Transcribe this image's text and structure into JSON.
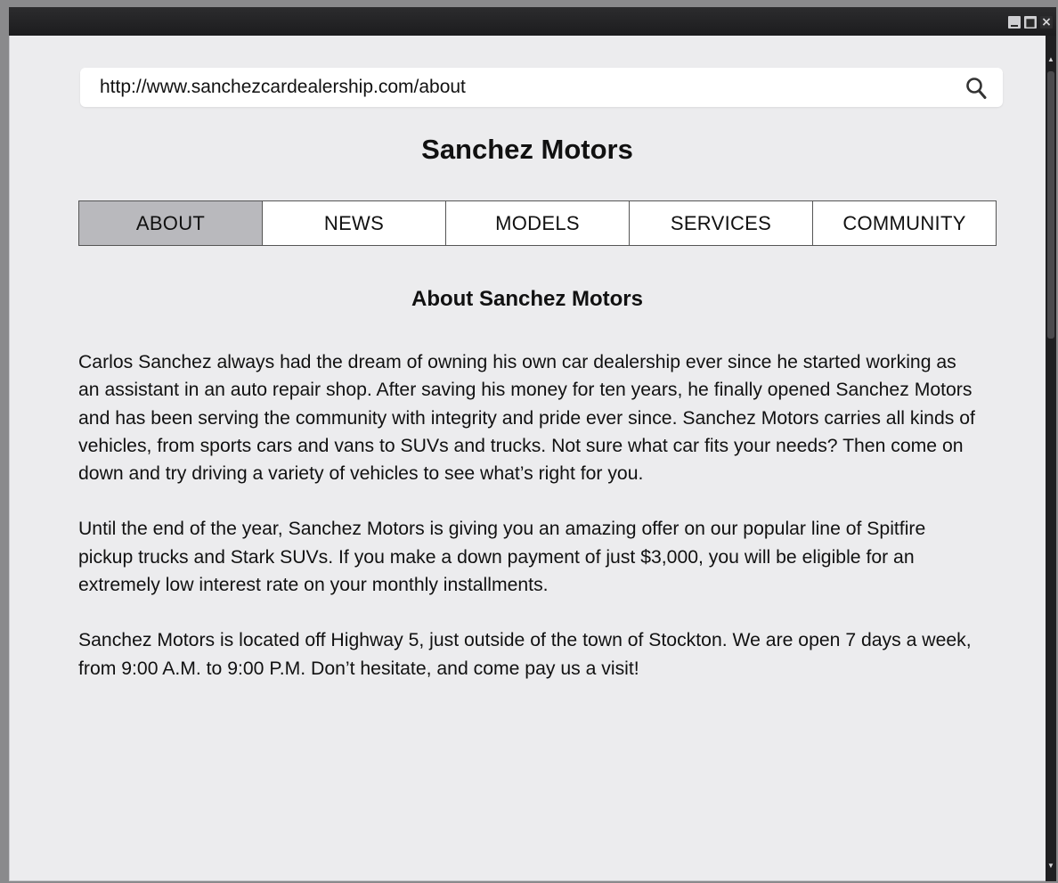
{
  "browser": {
    "url": "http://www.sanchezcardealership.com/about"
  },
  "site": {
    "title": "Sanchez Motors"
  },
  "nav": {
    "tabs": [
      {
        "label": "ABOUT",
        "active": true
      },
      {
        "label": "NEWS",
        "active": false
      },
      {
        "label": "MODELS",
        "active": false
      },
      {
        "label": "SERVICES",
        "active": false
      },
      {
        "label": "COMMUNITY",
        "active": false
      }
    ]
  },
  "main": {
    "heading": "About Sanchez Motors",
    "paragraphs": [
      "Carlos Sanchez always had the dream of owning his own car dealership ever since he started working as an assistant in an auto repair shop. After saving his money for ten years, he finally opened Sanchez Motors and has been serving the community with integrity and pride ever since. Sanchez Motors carries all kinds of vehicles, from sports cars and vans to SUVs and trucks. Not sure what car fits your needs? Then come on down and try driving a variety of vehicles to see what’s right for you.",
      "Until the end of the year, Sanchez Motors is giving you an amazing offer on our popular line of Spitfire pickup trucks and Stark SUVs. If you make a down payment of just $3,000, you will be eligible for an extremely low interest rate on your monthly installments.",
      "Sanchez Motors is located off Highway 5, just outside of the town of Stockton. We are open 7 days a week, from 9:00 A.M. to 9:00 P.M. Don’t hesitate, and come pay us a visit!"
    ]
  },
  "icons": {
    "search": "search-icon",
    "minimize": "minimize-icon",
    "maximize": "maximize-icon",
    "close": "close-icon"
  },
  "colors": {
    "titlebar": "#1c1c1e",
    "page_background": "#ececee",
    "active_tab": "#b9b9bd"
  }
}
